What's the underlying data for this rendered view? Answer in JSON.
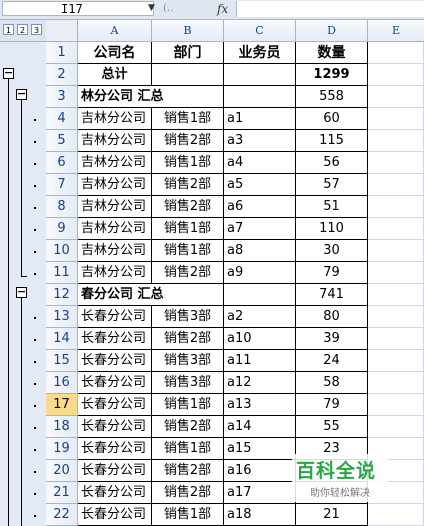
{
  "formula_bar": {
    "name_box": "I17",
    "fx_label": "fx",
    "formula": ""
  },
  "outline_levels": [
    "1",
    "2",
    "3"
  ],
  "outline_buttons": {
    "collapse": "−"
  },
  "columns": [
    "A",
    "B",
    "C",
    "D",
    "E"
  ],
  "rows": [
    {
      "num": "1",
      "a": "公司名",
      "b": "部门",
      "c": "业务员",
      "d": "数量",
      "type": "header"
    },
    {
      "num": "2",
      "a": "总计",
      "b": "",
      "c": "",
      "d": "1299",
      "type": "total"
    },
    {
      "num": "3",
      "a": "林分公司 汇总",
      "b": "",
      "c": "",
      "d": "558",
      "type": "subtotal"
    },
    {
      "num": "4",
      "a": "吉林分公司",
      "b": "销售1部",
      "c": "a1",
      "d": "60",
      "type": "detail"
    },
    {
      "num": "5",
      "a": "吉林分公司",
      "b": "销售2部",
      "c": "a3",
      "d": "115",
      "type": "detail"
    },
    {
      "num": "6",
      "a": "吉林分公司",
      "b": "销售1部",
      "c": "a4",
      "d": "56",
      "type": "detail"
    },
    {
      "num": "7",
      "a": "吉林分公司",
      "b": "销售2部",
      "c": "a5",
      "d": "57",
      "type": "detail"
    },
    {
      "num": "8",
      "a": "吉林分公司",
      "b": "销售2部",
      "c": "a6",
      "d": "51",
      "type": "detail"
    },
    {
      "num": "9",
      "a": "吉林分公司",
      "b": "销售1部",
      "c": "a7",
      "d": "110",
      "type": "detail"
    },
    {
      "num": "10",
      "a": "吉林分公司",
      "b": "销售1部",
      "c": "a8",
      "d": "30",
      "type": "detail"
    },
    {
      "num": "11",
      "a": "吉林分公司",
      "b": "销售2部",
      "c": "a9",
      "d": "79",
      "type": "detail"
    },
    {
      "num": "12",
      "a": "春分公司 汇总",
      "b": "",
      "c": "",
      "d": "741",
      "type": "subtotal"
    },
    {
      "num": "13",
      "a": "长春分公司",
      "b": "销售3部",
      "c": "a2",
      "d": "80",
      "type": "detail"
    },
    {
      "num": "14",
      "a": "长春分公司",
      "b": "销售2部",
      "c": "a10",
      "d": "39",
      "type": "detail"
    },
    {
      "num": "15",
      "a": "长春分公司",
      "b": "销售3部",
      "c": "a11",
      "d": "24",
      "type": "detail"
    },
    {
      "num": "16",
      "a": "长春分公司",
      "b": "销售3部",
      "c": "a12",
      "d": "58",
      "type": "detail"
    },
    {
      "num": "17",
      "a": "长春分公司",
      "b": "销售1部",
      "c": "a13",
      "d": "79",
      "type": "detail"
    },
    {
      "num": "18",
      "a": "长春分公司",
      "b": "销售2部",
      "c": "a14",
      "d": "55",
      "type": "detail"
    },
    {
      "num": "19",
      "a": "长春分公司",
      "b": "销售1部",
      "c": "a15",
      "d": "23",
      "type": "detail"
    },
    {
      "num": "20",
      "a": "长春分公司",
      "b": "销售2部",
      "c": "a16",
      "d": "",
      "type": "detail"
    },
    {
      "num": "21",
      "a": "长春分公司",
      "b": "销售2部",
      "c": "a17",
      "d": "",
      "type": "detail"
    },
    {
      "num": "22",
      "a": "长春分公司",
      "b": "销售1部",
      "c": "a18",
      "d": "21",
      "type": "detail"
    }
  ],
  "selected_row": "17",
  "watermark": {
    "main": "百科全说",
    "sub": "助你轻松解决"
  },
  "colors": {
    "accent_green": "#29a745",
    "selected_row": "#f9d98c",
    "header_blue": "#15428b"
  }
}
